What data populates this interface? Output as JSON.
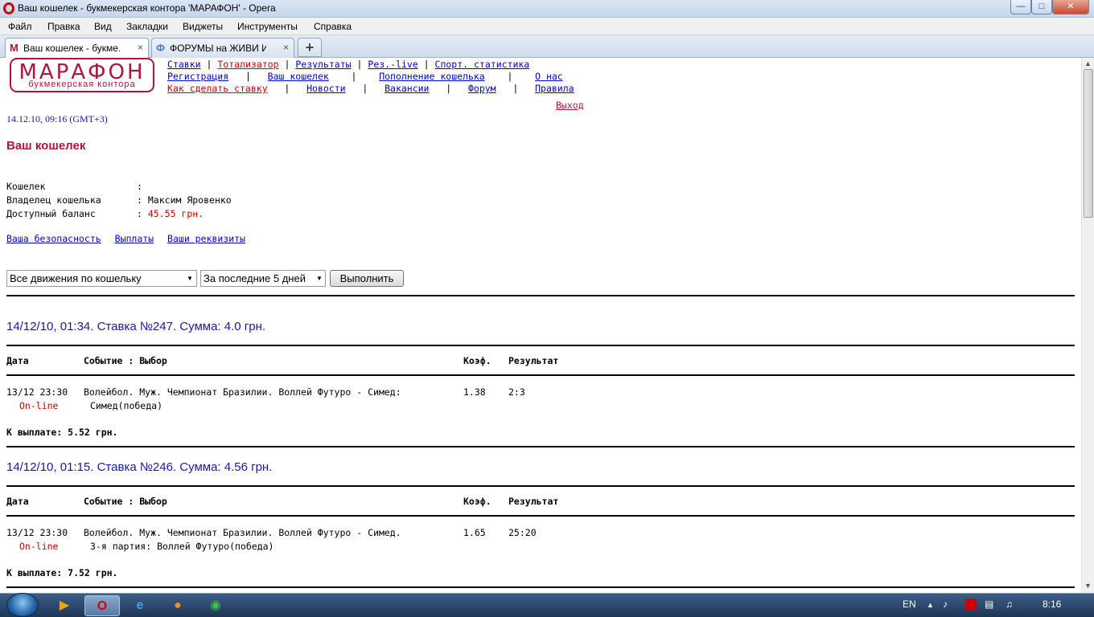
{
  "window": {
    "title": "Ваш кошелек - букмекерская контора 'МАРАФОН' - Opera",
    "minimize": "0",
    "maximize": "1",
    "close": "X"
  },
  "menu": [
    "Файл",
    "Правка",
    "Вид",
    "Закладки",
    "Виджеты",
    "Инструменты",
    "Справка"
  ],
  "tabs": [
    {
      "icon": "M",
      "label": "Ваш кошелек - букме...",
      "close": "×"
    },
    {
      "icon": "Ф",
      "label": "ФОРУМЫ на ЖИВИ И...",
      "close": "×"
    }
  ],
  "new_tab": "+",
  "logo": {
    "brand": "МАРАФОН",
    "sub": "букмекерская контора"
  },
  "nav": {
    "row1": [
      "Ставки",
      "Тотализатор",
      "Результаты",
      "Рез.-live",
      "Спорт. статистика"
    ],
    "row2": [
      "Регистрация",
      "Ваш кошелек",
      "Пополнение кошелька",
      "О нас"
    ],
    "row3": [
      "Как сделать ставку",
      "Новости",
      "Вакансии",
      "Форум",
      "Правила"
    ],
    "separator": "|",
    "logout": "Выход"
  },
  "datetime": "14.12.10, 09:16 (GMT+3)",
  "heading": "Ваш кошелек",
  "wallet": {
    "wallet_label": "Кошелек",
    "wallet_value": "",
    "owner_label": "Владелец кошелька",
    "owner_value": "Максим Яровенко",
    "balance_label": "Доступный баланс",
    "balance_value": "45.55 грн.",
    "colon": ":"
  },
  "account_links": [
    "Ваша безопасность",
    "Выплаты",
    "Ваши реквизиты"
  ],
  "filters": {
    "movement": "Все движения по кошельку",
    "period": "За последние 5 дней",
    "submit": "Выполнить"
  },
  "table_headers": {
    "date": "Дата",
    "event": "Событие : Выбор",
    "coef": "Коэф.",
    "result": "Результат"
  },
  "bets": [
    {
      "title": "14/12/10, 01:34. Ставка №247. Сумма: 4.0 грн.",
      "date": "13/12 23:30",
      "event": "Волейбол. Муж. Чемпионат Бразилии. Воллей Футуро - Симед:",
      "status": "On-line",
      "selection": "Симед(победа)",
      "coef": "1.38",
      "result": "2:3",
      "payout": "К выплате: 5.52 грн."
    },
    {
      "title": "14/12/10, 01:15. Ставка №246. Сумма: 4.56 грн.",
      "date": "13/12 23:30",
      "event": "Волейбол. Муж. Чемпионат Бразилии. Воллей Футуро - Симед.",
      "status": "On-line",
      "selection": "3-я партия: Воллей Футуро(победа)",
      "coef": "1.65",
      "result": "25:20",
      "payout": "К выплате: 7.52 грн."
    }
  ],
  "taskbar": {
    "lang": "EN",
    "clock": "8:16"
  },
  "colors": {
    "brand": "#b0153c",
    "link": "#0000cc",
    "heading_blue": "#1a1aa0",
    "alert_red": "#cc0000"
  }
}
